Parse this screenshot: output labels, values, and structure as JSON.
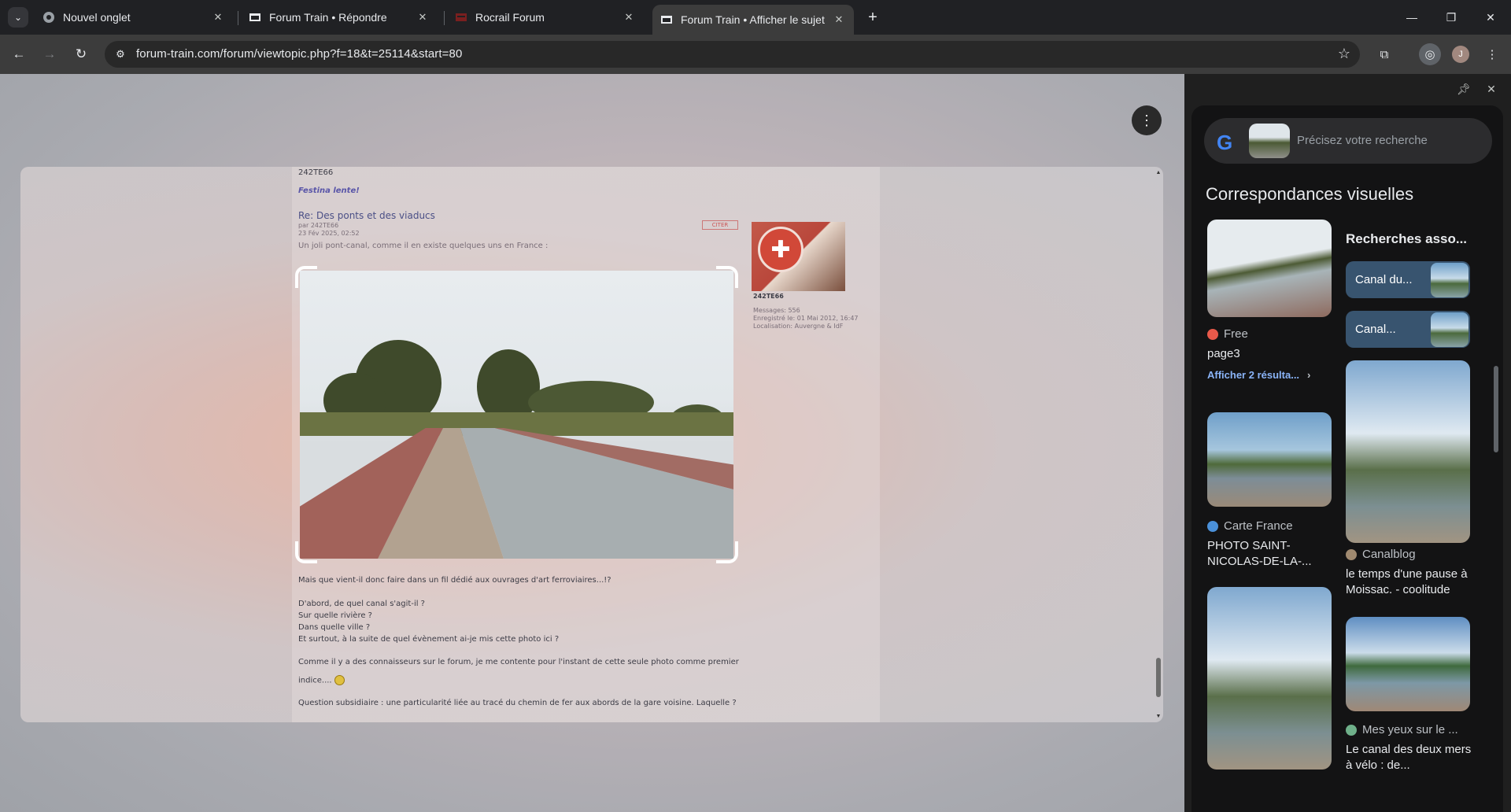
{
  "browser": {
    "tabs": [
      {
        "title": "Nouvel onglet",
        "favicon": "chrome-icon",
        "active": false
      },
      {
        "title": "Forum Train • Répondre",
        "favicon": "forum-train-icon",
        "active": false
      },
      {
        "title": "Rocrail Forum",
        "favicon": "rocrail-icon",
        "active": false
      },
      {
        "title": "Forum Train • Afficher le sujet -",
        "favicon": "forum-train-icon",
        "active": true
      }
    ],
    "url": "forum-train.com/forum/viewtopic.php?f=18&t=25114&start=80",
    "profile_initial": "J"
  },
  "forum": {
    "prev_signature_user": "242TE66",
    "prev_signature_motto": "Festina lente!",
    "post_title": "Re: Des ponts et des viaducs",
    "post_by": "par 242TE66",
    "post_date": "23 Fév 2025, 02:52",
    "post_intro": "Un joli pont-canal, comme il en existe quelques uns en France :",
    "quote_label": "CITER",
    "author": {
      "name": "242TE66",
      "messages": "Messages: 556",
      "registered": "Enregistré le: 01 Mai 2012, 16:47",
      "location": "Localisation: Auvergne & IdF"
    },
    "body": [
      "Mais que vient-il donc faire dans un fil dédié aux ouvrages d'art ferroviaires...!?",
      "D'abord, de quel canal s'agit-il ?",
      "Sur quelle rivière ?",
      "Dans quelle ville ?",
      "Et surtout, à la suite de quel évènement ai-je mis cette photo ici ?",
      "Comme il y a des connaisseurs sur le forum, je me contente pour l'instant de cette seule photo comme premier",
      "indice....",
      "Question subsidiaire : une particularité liée au tracé du chemin de fer aux abords de la gare voisine. Laquelle ?"
    ]
  },
  "lens": {
    "search_placeholder": "Précisez votre recherche",
    "section_title": "Correspondances visuelles",
    "related_title": "Recherches asso...",
    "related_chips": [
      "Canal du...",
      "Canal..."
    ],
    "results": [
      {
        "source": "Free",
        "title": "page3",
        "more": "Afficher 2 résulta...",
        "source_color": "#e8594a"
      },
      {
        "source": "Carte France",
        "title": "PHOTO SAINT-NICOLAS-DE-LA-...",
        "source_color": "#4a90d9"
      },
      {
        "source": "Canalblog",
        "title": "le temps d'une pause à Moissac. - coolitude",
        "source_color": "#a08a70"
      },
      {
        "source": "Mes yeux sur le ...",
        "title": "Le canal des deux mers à vélo : de...",
        "source_color": "#6fb08a"
      }
    ]
  }
}
